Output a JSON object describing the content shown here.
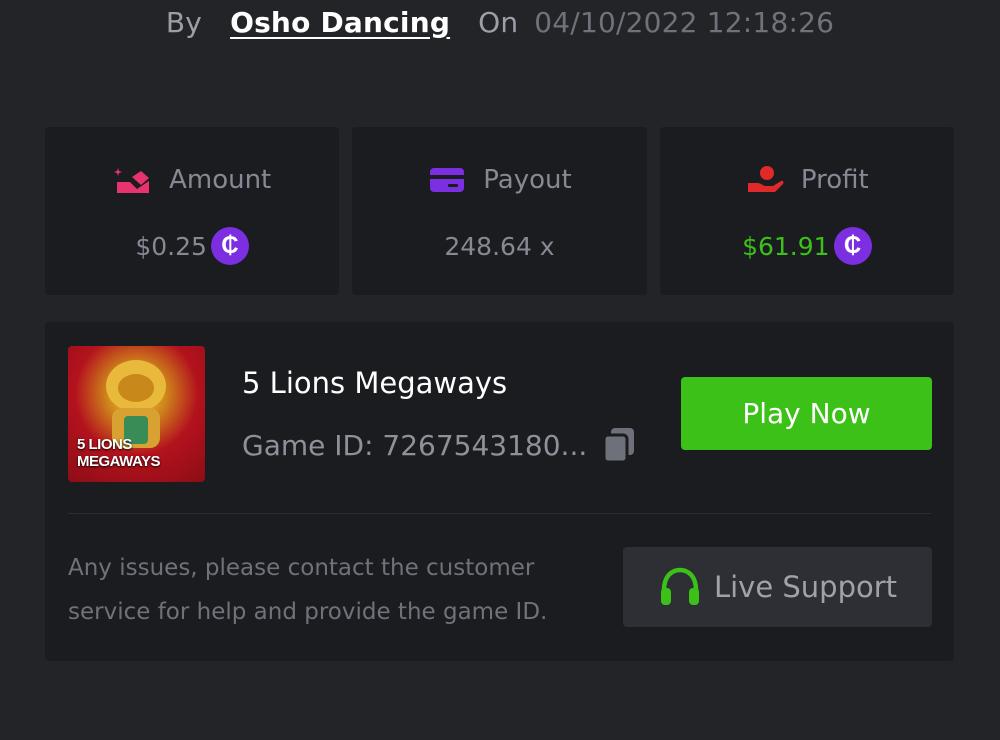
{
  "header": {
    "by_label": "By",
    "username": "Osho Dancing",
    "on_label": "On",
    "timestamp": "04/10/2022 12:18:26"
  },
  "stats": {
    "amount": {
      "label": "Amount",
      "value": "$0.25",
      "icon": "amount-bet-icon",
      "icon_color": "#e8336e"
    },
    "payout": {
      "label": "Payout",
      "value": "248.64 x",
      "icon": "card-icon",
      "icon_color": "#7b2fe0"
    },
    "profit": {
      "label": "Profit",
      "value": "$61.91",
      "icon": "hand-coin-icon",
      "icon_color": "#e02a2a",
      "value_color": "#3bc117"
    },
    "coin_symbol": "₵"
  },
  "game": {
    "title": "5 Lions Megaways",
    "thumbnail_text_line1": "5 LIONS",
    "thumbnail_text_line2": "MEGAWAYS",
    "game_id": "Game ID: 7267543180...",
    "play_button": "Play Now"
  },
  "support": {
    "help_text": "Any issues, please contact the customer service for help and provide the game ID.",
    "button_label": "Live Support"
  },
  "colors": {
    "background": "#232428",
    "card": "#1b1c20",
    "accent_green": "#3bc117",
    "coin_purple": "#7b2fe0"
  }
}
